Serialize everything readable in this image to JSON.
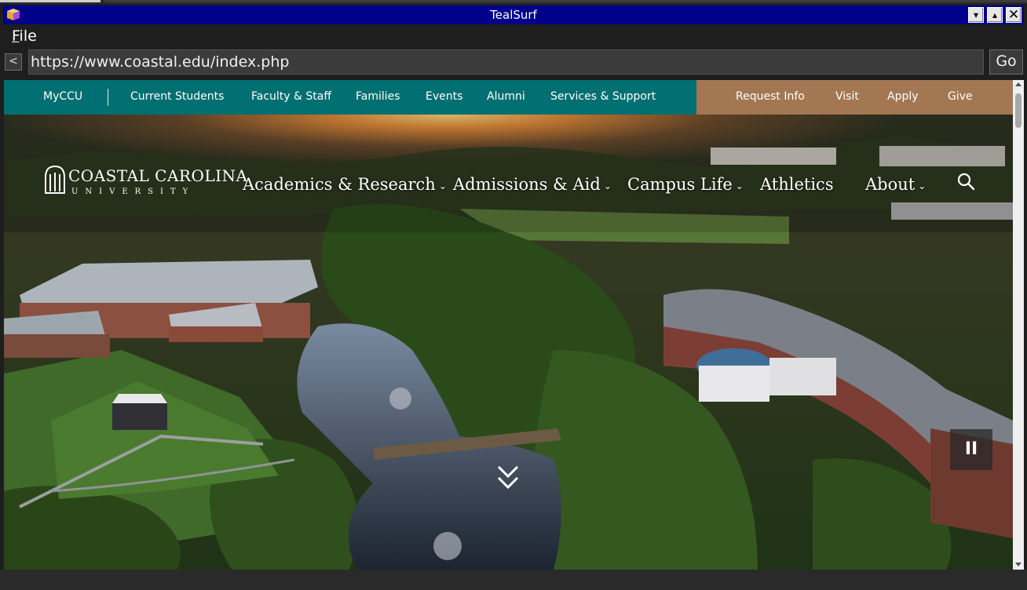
{
  "window": {
    "title": "TealSurf",
    "minimize_label": "▾",
    "maximize_label": "▴",
    "close_label": "✕"
  },
  "menubar": {
    "file_label_accel": "F",
    "file_label_rest": "ile"
  },
  "address_bar": {
    "back_label": "<",
    "url": "https://www.coastal.edu/index.php",
    "go_label": "Go"
  },
  "utility_nav": {
    "left": [
      "MyCCU",
      "Current Students",
      "Faculty & Staff",
      "Families",
      "Events",
      "Alumni",
      "Services & Support"
    ],
    "right": [
      "Request Info",
      "Visit",
      "Apply",
      "Give"
    ]
  },
  "logo": {
    "name": "COASTAL CAROLINA",
    "sub": "UNIVERSITY"
  },
  "main_nav": [
    {
      "label": "Academics & Research",
      "has_dropdown": true
    },
    {
      "label": "Admissions & Aid",
      "has_dropdown": true
    },
    {
      "label": "Campus Life",
      "has_dropdown": true
    },
    {
      "label": "Athletics",
      "has_dropdown": false
    },
    {
      "label": "About",
      "has_dropdown": true
    }
  ],
  "hero": {
    "pause_label": "II"
  },
  "colors": {
    "titlebar": "#00008b",
    "utility_teal": "#006f71",
    "utility_bronze": "#a27752"
  },
  "icons": {
    "app": "browser-book-icon",
    "search": "search-icon",
    "scroll": "double-chevron-down-icon"
  }
}
